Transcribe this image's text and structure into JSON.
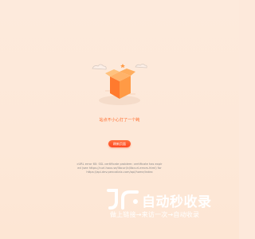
{
  "page": {
    "message": "站点不小心打了一个盹",
    "reload_button": "刷新页面",
    "error_detail": "cURL error 60: SSL certificate problem: certificate has expired (see https://curl.haxx.se/libcurl/c/libcurl-errors.html) for https://api-dev.pencailaix.com/api/home/index"
  },
  "watermark": {
    "title": "自动秒收录",
    "subtitle": "做上链接→来访一次→自动收录",
    "logo_icon": "ji-logo-icon"
  },
  "colors": {
    "background": "#fde9db",
    "accent": "#ff5a2a",
    "box": "#ff8a3c"
  }
}
